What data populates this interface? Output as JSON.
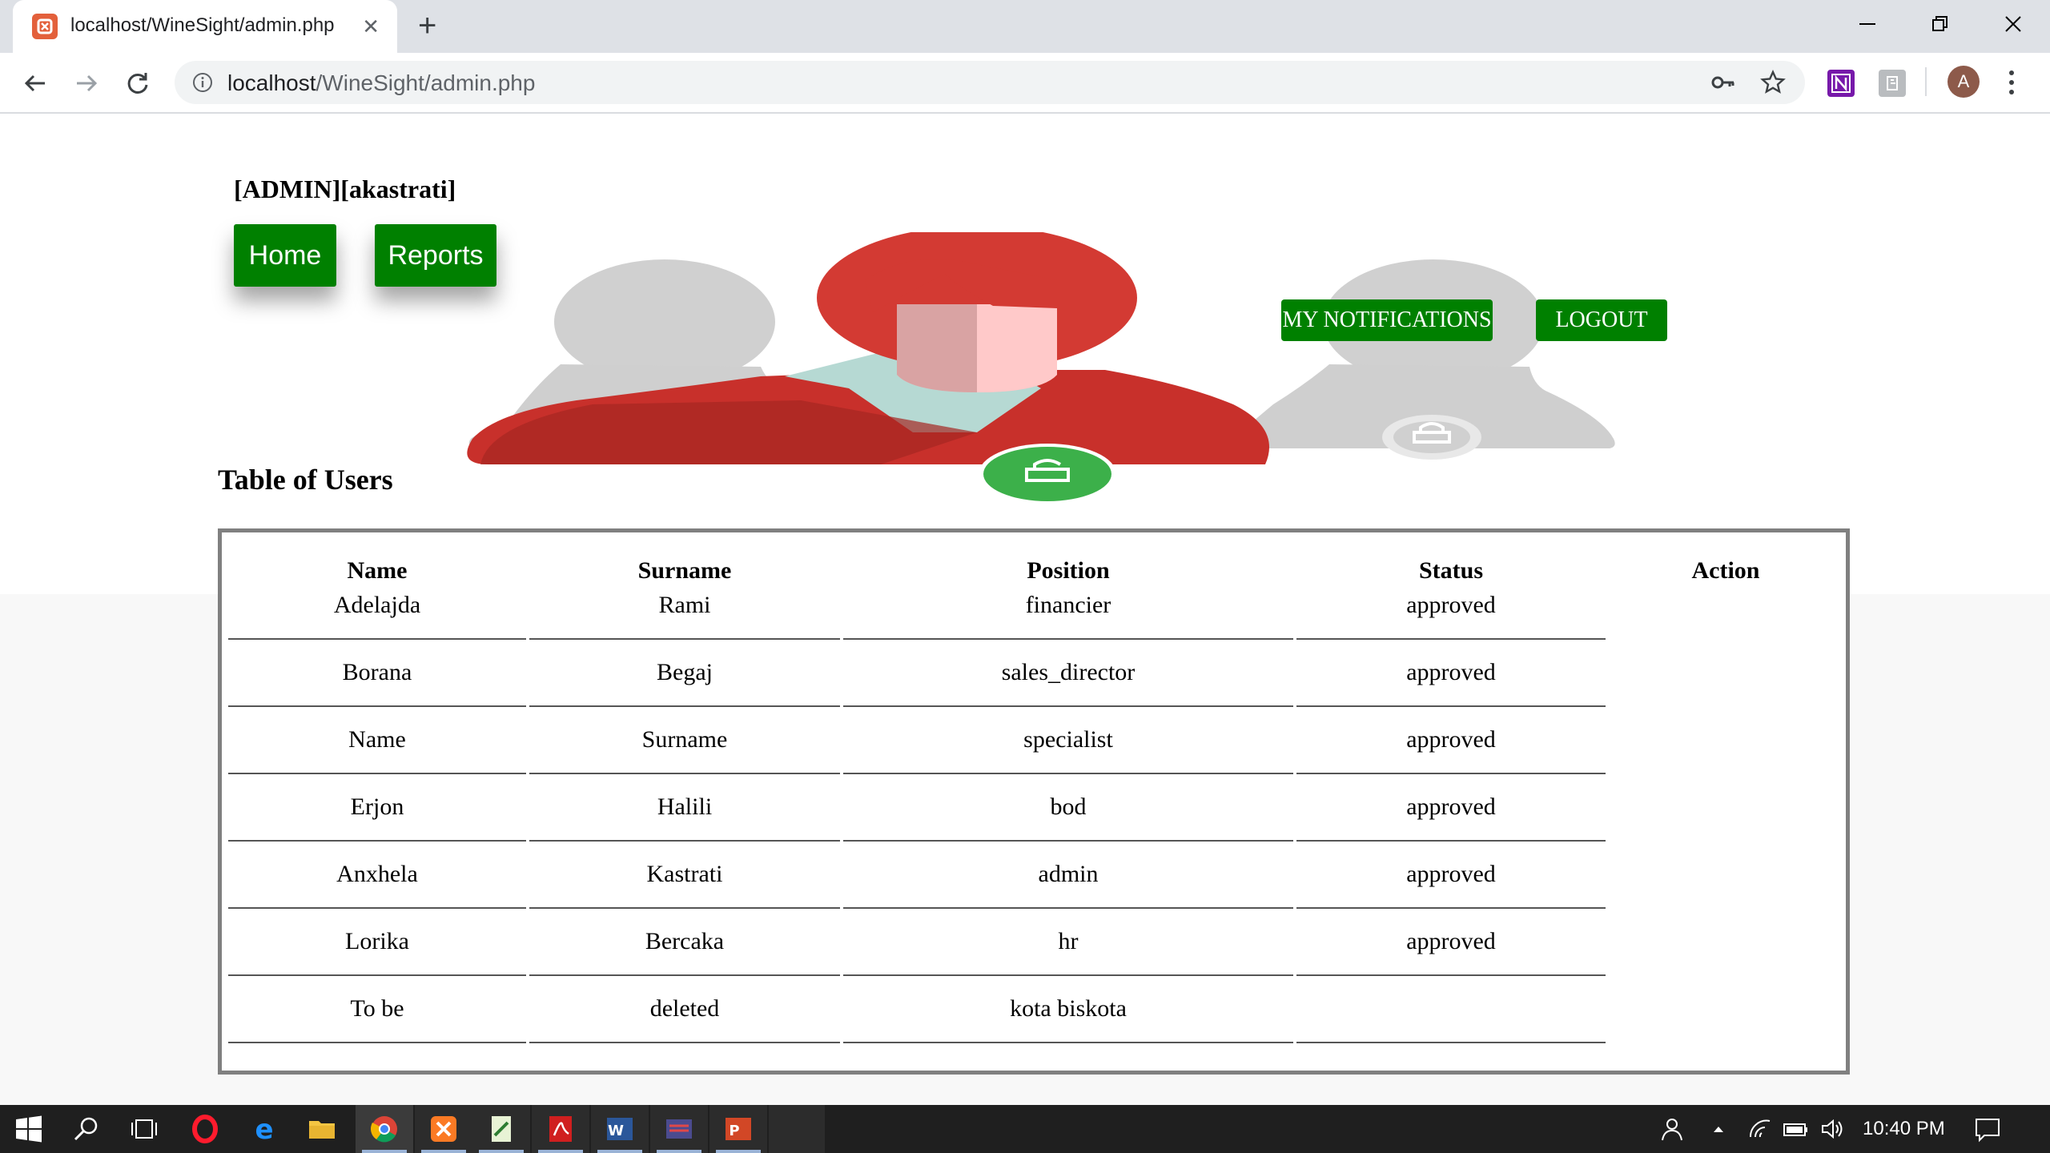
{
  "browser": {
    "tab_title": "localhost/WineSight/admin.php",
    "url_host": "localhost",
    "url_path": "/WineSight/admin.php"
  },
  "header": {
    "admin_tag": "[ADMIN][akastrati]",
    "home_label": "Home",
    "reports_label": "Reports",
    "notifications_label": "MY NOTIFICATIONS",
    "logout_label": "LOGOUT"
  },
  "users_table": {
    "title": "Table of Users",
    "columns": [
      "Name",
      "Surname",
      "Position",
      "Status",
      "Action"
    ],
    "rows": [
      [
        "Adelajda",
        "Rami",
        "financier",
        "approved",
        ""
      ],
      [
        "Borana",
        "Begaj",
        "sales_director",
        "approved",
        ""
      ],
      [
        "Name",
        "Surname",
        "specialist",
        "approved",
        ""
      ],
      [
        "Erjon",
        "Halili",
        "bod",
        "approved",
        ""
      ],
      [
        "Anxhela",
        "Kastrati",
        "admin",
        "approved",
        ""
      ],
      [
        "Lorika",
        "Bercaka",
        "hr",
        "approved",
        ""
      ],
      [
        "To be",
        "deleted",
        "kota biskota",
        "",
        ""
      ]
    ]
  },
  "taskbar": {
    "clock": "10:40 PM"
  },
  "colors": {
    "primary_green": "#008000",
    "avatar_red": "#d33a33",
    "avatar_grey": "#cccccc"
  }
}
